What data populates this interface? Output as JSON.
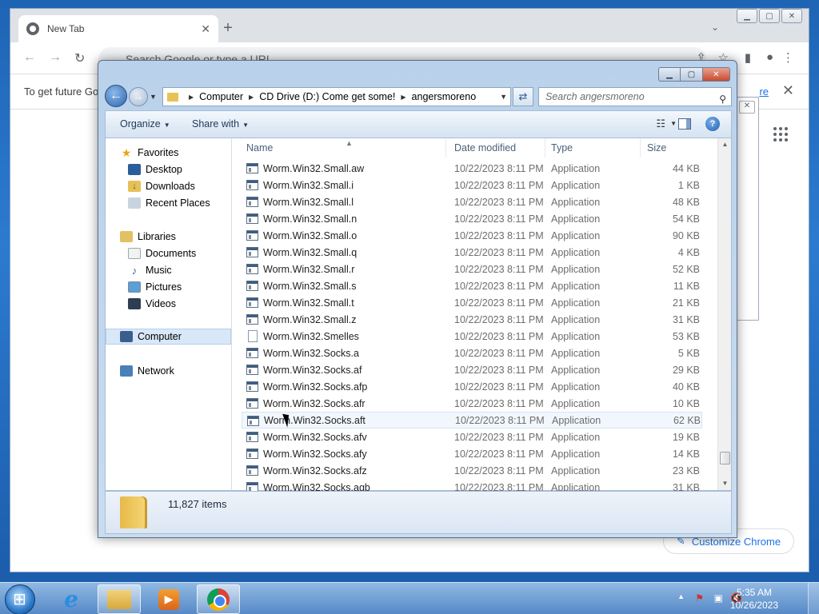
{
  "chrome": {
    "tab_title": "New Tab",
    "omnibox_placeholder": "Search Google or type a URL",
    "infobar_text": "To get future Go",
    "infobar_link": "re",
    "customize_label": "Customize Chrome"
  },
  "explorer": {
    "breadcrumb": [
      "Computer",
      "CD Drive (D:) Come get some!",
      "angersmoreno"
    ],
    "search_placeholder": "Search angersmoreno",
    "toolbar": {
      "organize": "Organize",
      "share_with": "Share with"
    },
    "nav": {
      "favorites": "Favorites",
      "desktop": "Desktop",
      "downloads": "Downloads",
      "recent": "Recent Places",
      "libraries": "Libraries",
      "documents": "Documents",
      "music": "Music",
      "pictures": "Pictures",
      "videos": "Videos",
      "computer": "Computer",
      "network": "Network"
    },
    "columns": {
      "name": "Name",
      "date": "Date modified",
      "type": "Type",
      "size": "Size"
    },
    "files": [
      {
        "name": "Worm.Win32.Small.aw",
        "date": "10/22/2023 8:11 PM",
        "type": "Application",
        "size": "44 KB",
        "icon": "app"
      },
      {
        "name": "Worm.Win32.Small.i",
        "date": "10/22/2023 8:11 PM",
        "type": "Application",
        "size": "1 KB",
        "icon": "app"
      },
      {
        "name": "Worm.Win32.Small.l",
        "date": "10/22/2023 8:11 PM",
        "type": "Application",
        "size": "48 KB",
        "icon": "app"
      },
      {
        "name": "Worm.Win32.Small.n",
        "date": "10/22/2023 8:11 PM",
        "type": "Application",
        "size": "54 KB",
        "icon": "app"
      },
      {
        "name": "Worm.Win32.Small.o",
        "date": "10/22/2023 8:11 PM",
        "type": "Application",
        "size": "90 KB",
        "icon": "app"
      },
      {
        "name": "Worm.Win32.Small.q",
        "date": "10/22/2023 8:11 PM",
        "type": "Application",
        "size": "4 KB",
        "icon": "app"
      },
      {
        "name": "Worm.Win32.Small.r",
        "date": "10/22/2023 8:11 PM",
        "type": "Application",
        "size": "52 KB",
        "icon": "app"
      },
      {
        "name": "Worm.Win32.Small.s",
        "date": "10/22/2023 8:11 PM",
        "type": "Application",
        "size": "11 KB",
        "icon": "app"
      },
      {
        "name": "Worm.Win32.Small.t",
        "date": "10/22/2023 8:11 PM",
        "type": "Application",
        "size": "21 KB",
        "icon": "app"
      },
      {
        "name": "Worm.Win32.Small.z",
        "date": "10/22/2023 8:11 PM",
        "type": "Application",
        "size": "31 KB",
        "icon": "app"
      },
      {
        "name": "Worm.Win32.Smelles",
        "date": "10/22/2023 8:11 PM",
        "type": "Application",
        "size": "53 KB",
        "icon": "doc"
      },
      {
        "name": "Worm.Win32.Socks.a",
        "date": "10/22/2023 8:11 PM",
        "type": "Application",
        "size": "5 KB",
        "icon": "app"
      },
      {
        "name": "Worm.Win32.Socks.af",
        "date": "10/22/2023 8:11 PM",
        "type": "Application",
        "size": "29 KB",
        "icon": "app"
      },
      {
        "name": "Worm.Win32.Socks.afp",
        "date": "10/22/2023 8:11 PM",
        "type": "Application",
        "size": "40 KB",
        "icon": "app"
      },
      {
        "name": "Worm.Win32.Socks.afr",
        "date": "10/22/2023 8:11 PM",
        "type": "Application",
        "size": "10 KB",
        "icon": "app"
      },
      {
        "name": "Worm.Win32.Socks.aft",
        "date": "10/22/2023 8:11 PM",
        "type": "Application",
        "size": "62 KB",
        "icon": "app",
        "hover": true
      },
      {
        "name": "Worm.Win32.Socks.afv",
        "date": "10/22/2023 8:11 PM",
        "type": "Application",
        "size": "19 KB",
        "icon": "app"
      },
      {
        "name": "Worm.Win32.Socks.afy",
        "date": "10/22/2023 8:11 PM",
        "type": "Application",
        "size": "14 KB",
        "icon": "app"
      },
      {
        "name": "Worm.Win32.Socks.afz",
        "date": "10/22/2023 8:11 PM",
        "type": "Application",
        "size": "23 KB",
        "icon": "app"
      },
      {
        "name": "Worm.Win32.Socks.agb",
        "date": "10/22/2023 8:11 PM",
        "type": "Application",
        "size": "31 KB",
        "icon": "app"
      }
    ],
    "status": {
      "item_count": "11,827 items"
    }
  },
  "taskbar": {
    "clock_time": "5:35 AM",
    "clock_date": "10/26/2023",
    "pinned": [
      "internet-explorer",
      "windows-explorer",
      "windows-media-player",
      "google-chrome"
    ]
  }
}
